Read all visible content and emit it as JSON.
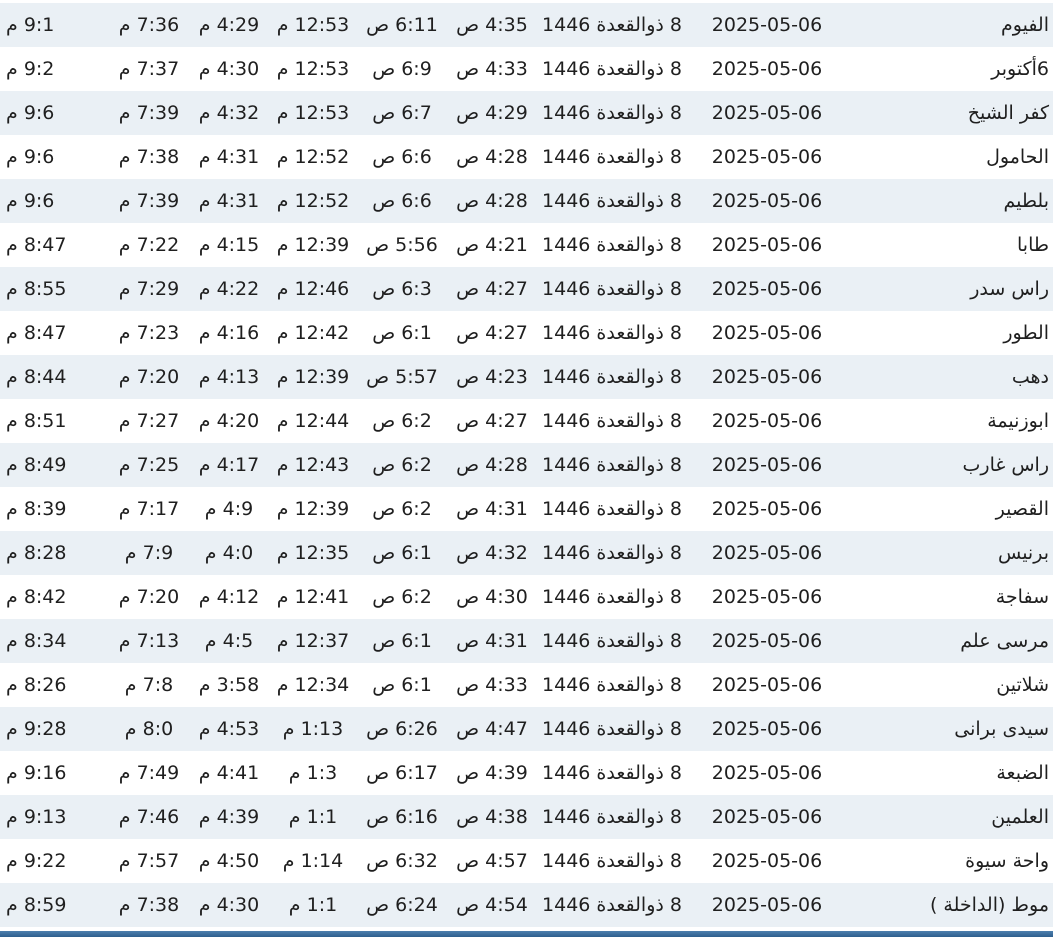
{
  "rows": [
    {
      "city": "الفيوم",
      "date": "2025-05-06",
      "hijri": "8 ذوالقعدة 1446",
      "fajr": "4:35 ص",
      "sunrise": "6:11 ص",
      "dhuhr": "12:53 م",
      "asr": "4:29 م",
      "maghrib": "7:36 م",
      "isha": "9:1 م"
    },
    {
      "city": "6أكتوبر",
      "date": "2025-05-06",
      "hijri": "8 ذوالقعدة 1446",
      "fajr": "4:33 ص",
      "sunrise": "6:9 ص",
      "dhuhr": "12:53 م",
      "asr": "4:30 م",
      "maghrib": "7:37 م",
      "isha": "9:2 م"
    },
    {
      "city": "كفر الشيخ",
      "date": "2025-05-06",
      "hijri": "8 ذوالقعدة 1446",
      "fajr": "4:29 ص",
      "sunrise": "6:7 ص",
      "dhuhr": "12:53 م",
      "asr": "4:32 م",
      "maghrib": "7:39 م",
      "isha": "9:6 م"
    },
    {
      "city": "الحامول",
      "date": "2025-05-06",
      "hijri": "8 ذوالقعدة 1446",
      "fajr": "4:28 ص",
      "sunrise": "6:6 ص",
      "dhuhr": "12:52 م",
      "asr": "4:31 م",
      "maghrib": "7:38 م",
      "isha": "9:6 م"
    },
    {
      "city": "بلطيم",
      "date": "2025-05-06",
      "hijri": "8 ذوالقعدة 1446",
      "fajr": "4:28 ص",
      "sunrise": "6:6 ص",
      "dhuhr": "12:52 م",
      "asr": "4:31 م",
      "maghrib": "7:39 م",
      "isha": "9:6 م"
    },
    {
      "city": "طابا",
      "date": "2025-05-06",
      "hijri": "8 ذوالقعدة 1446",
      "fajr": "4:21 ص",
      "sunrise": "5:56 ص",
      "dhuhr": "12:39 م",
      "asr": "4:15 م",
      "maghrib": "7:22 م",
      "isha": "8:47 م"
    },
    {
      "city": "راس سدر",
      "date": "2025-05-06",
      "hijri": "8 ذوالقعدة 1446",
      "fajr": "4:27 ص",
      "sunrise": "6:3 ص",
      "dhuhr": "12:46 م",
      "asr": "4:22 م",
      "maghrib": "7:29 م",
      "isha": "8:55 م"
    },
    {
      "city": "الطور",
      "date": "2025-05-06",
      "hijri": "8 ذوالقعدة 1446",
      "fajr": "4:27 ص",
      "sunrise": "6:1 ص",
      "dhuhr": "12:42 م",
      "asr": "4:16 م",
      "maghrib": "7:23 م",
      "isha": "8:47 م"
    },
    {
      "city": "دهب",
      "date": "2025-05-06",
      "hijri": "8 ذوالقعدة 1446",
      "fajr": "4:23 ص",
      "sunrise": "5:57 ص",
      "dhuhr": "12:39 م",
      "asr": "4:13 م",
      "maghrib": "7:20 م",
      "isha": "8:44 م"
    },
    {
      "city": "ابوزنيمة",
      "date": "2025-05-06",
      "hijri": "8 ذوالقعدة 1446",
      "fajr": "4:27 ص",
      "sunrise": "6:2 ص",
      "dhuhr": "12:44 م",
      "asr": "4:20 م",
      "maghrib": "7:27 م",
      "isha": "8:51 م"
    },
    {
      "city": "راس غارب",
      "date": "2025-05-06",
      "hijri": "8 ذوالقعدة 1446",
      "fajr": "4:28 ص",
      "sunrise": "6:2 ص",
      "dhuhr": "12:43 م",
      "asr": "4:17 م",
      "maghrib": "7:25 م",
      "isha": "8:49 م"
    },
    {
      "city": "القصير",
      "date": "2025-05-06",
      "hijri": "8 ذوالقعدة 1446",
      "fajr": "4:31 ص",
      "sunrise": "6:2 ص",
      "dhuhr": "12:39 م",
      "asr": "4:9 م",
      "maghrib": "7:17 م",
      "isha": "8:39 م"
    },
    {
      "city": "برنيس",
      "date": "2025-05-06",
      "hijri": "8 ذوالقعدة 1446",
      "fajr": "4:32 ص",
      "sunrise": "6:1 ص",
      "dhuhr": "12:35 م",
      "asr": "4:0 م",
      "maghrib": "7:9 م",
      "isha": "8:28 م"
    },
    {
      "city": "سفاجة",
      "date": "2025-05-06",
      "hijri": "8 ذوالقعدة 1446",
      "fajr": "4:30 ص",
      "sunrise": "6:2 ص",
      "dhuhr": "12:41 م",
      "asr": "4:12 م",
      "maghrib": "7:20 م",
      "isha": "8:42 م"
    },
    {
      "city": "مرسى علم",
      "date": "2025-05-06",
      "hijri": "8 ذوالقعدة 1446",
      "fajr": "4:31 ص",
      "sunrise": "6:1 ص",
      "dhuhr": "12:37 م",
      "asr": "4:5 م",
      "maghrib": "7:13 م",
      "isha": "8:34 م"
    },
    {
      "city": "شلاتين",
      "date": "2025-05-06",
      "hijri": "8 ذوالقعدة 1446",
      "fajr": "4:33 ص",
      "sunrise": "6:1 ص",
      "dhuhr": "12:34 م",
      "asr": "3:58 م",
      "maghrib": "7:8 م",
      "isha": "8:26 م"
    },
    {
      "city": "سيدى برانى",
      "date": "2025-05-06",
      "hijri": "8 ذوالقعدة 1446",
      "fajr": "4:47 ص",
      "sunrise": "6:26 ص",
      "dhuhr": "1:13 م",
      "asr": "4:53 م",
      "maghrib": "8:0 م",
      "isha": "9:28 م"
    },
    {
      "city": "الضبعة",
      "date": "2025-05-06",
      "hijri": "8 ذوالقعدة 1446",
      "fajr": "4:39 ص",
      "sunrise": "6:17 ص",
      "dhuhr": "1:3 م",
      "asr": "4:41 م",
      "maghrib": "7:49 م",
      "isha": "9:16 م"
    },
    {
      "city": "العلمين",
      "date": "2025-05-06",
      "hijri": "8 ذوالقعدة 1446",
      "fajr": "4:38 ص",
      "sunrise": "6:16 ص",
      "dhuhr": "1:1 م",
      "asr": "4:39 م",
      "maghrib": "7:46 م",
      "isha": "9:13 م"
    },
    {
      "city": "واحة سيوة",
      "date": "2025-05-06",
      "hijri": "8 ذوالقعدة 1446",
      "fajr": "4:57 ص",
      "sunrise": "6:32 ص",
      "dhuhr": "1:14 م",
      "asr": "4:50 م",
      "maghrib": "7:57 م",
      "isha": "9:22 م"
    },
    {
      "city": "موط (الداخلة )",
      "date": "2025-05-06",
      "hijri": "8 ذوالقعدة 1446",
      "fajr": "4:54 ص",
      "sunrise": "6:24 ص",
      "dhuhr": "1:1 م",
      "asr": "4:30 م",
      "maghrib": "7:38 م",
      "isha": "8:59 م"
    }
  ]
}
